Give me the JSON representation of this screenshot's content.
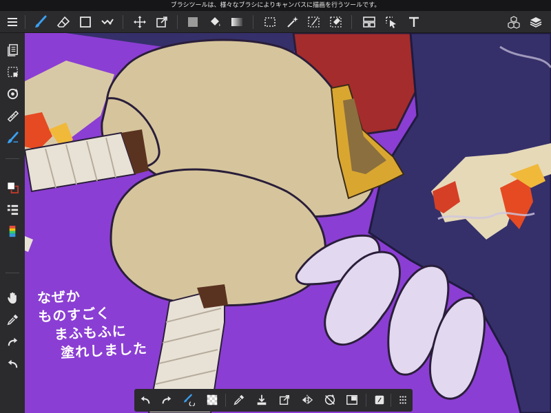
{
  "hint_text": "ブラシツールは、様々なブラシによりキャンバスに描画を行うツールです。",
  "canvas_text": [
    "なぜか",
    "ものすごく",
    "まふもふに",
    "塗れしました"
  ],
  "colors": {
    "toolbar_bg": "#2b2b2e",
    "canvas_bg": "#8b3ed3",
    "active_tool": "#3aa0f0",
    "primary_swatch": "#ffffff",
    "secondary_swatch": "#c0392b"
  },
  "top_toolbar": [
    {
      "name": "menu-icon",
      "active": false
    },
    {
      "name": "brush-icon",
      "active": true
    },
    {
      "name": "eraser-icon",
      "active": false
    },
    {
      "name": "object-icon",
      "active": false
    },
    {
      "name": "snap-icon",
      "active": false
    },
    {
      "name": "move-icon",
      "active": false
    },
    {
      "name": "transform-icon",
      "active": false
    },
    {
      "name": "fill-rect-icon",
      "active": false
    },
    {
      "name": "bucket-icon",
      "active": false
    },
    {
      "name": "gradient-icon",
      "active": false
    },
    {
      "name": "select-rect-icon",
      "active": false
    },
    {
      "name": "magic-wand-icon",
      "active": false
    },
    {
      "name": "select-pen-icon",
      "active": false
    },
    {
      "name": "select-eraser-icon",
      "active": false
    },
    {
      "name": "frame-divider-icon",
      "active": false
    },
    {
      "name": "operation-icon",
      "active": false
    },
    {
      "name": "text-icon",
      "active": false
    },
    {
      "name": "material-icon",
      "active": false
    },
    {
      "name": "layers-icon",
      "active": false
    }
  ],
  "sidebar_tools": [
    "pages-icon",
    "selection-icon",
    "rotate-icon",
    "ruler-icon",
    "brush-settings-icon",
    "color-swatch-icon",
    "layer-list-icon",
    "color-palette-icon",
    "hand-icon",
    "eyedropper-icon",
    "redo-icon",
    "undo-icon"
  ],
  "bottom_toolbar": [
    "undo-icon",
    "redo-icon",
    "brush-swap-icon",
    "transparent-icon",
    "eyedropper-icon",
    "save-icon",
    "export-icon",
    "flip-icon",
    "rotate-reset-icon",
    "snapshot-icon",
    "reference-icon",
    "more-icon"
  ]
}
